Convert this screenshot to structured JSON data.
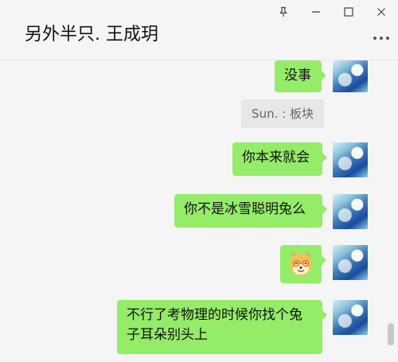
{
  "window": {
    "chat_title": "另外半只. 王成玥"
  },
  "messages": {
    "m1": "没事",
    "system_note": "Sun. : 板块",
    "m2": "你本来就会",
    "m3": "你不是冰雪聪明兔么",
    "m4_icon": "dog-emoji-icon",
    "m5_line1": "不行了考物理的时候你找个兔",
    "m5_line2": "子耳朵别头上"
  },
  "icons": {
    "pin": "pin-icon",
    "minimize": "minimize-icon",
    "maximize": "maximize-icon",
    "close": "close-icon",
    "more": "more-icon"
  }
}
